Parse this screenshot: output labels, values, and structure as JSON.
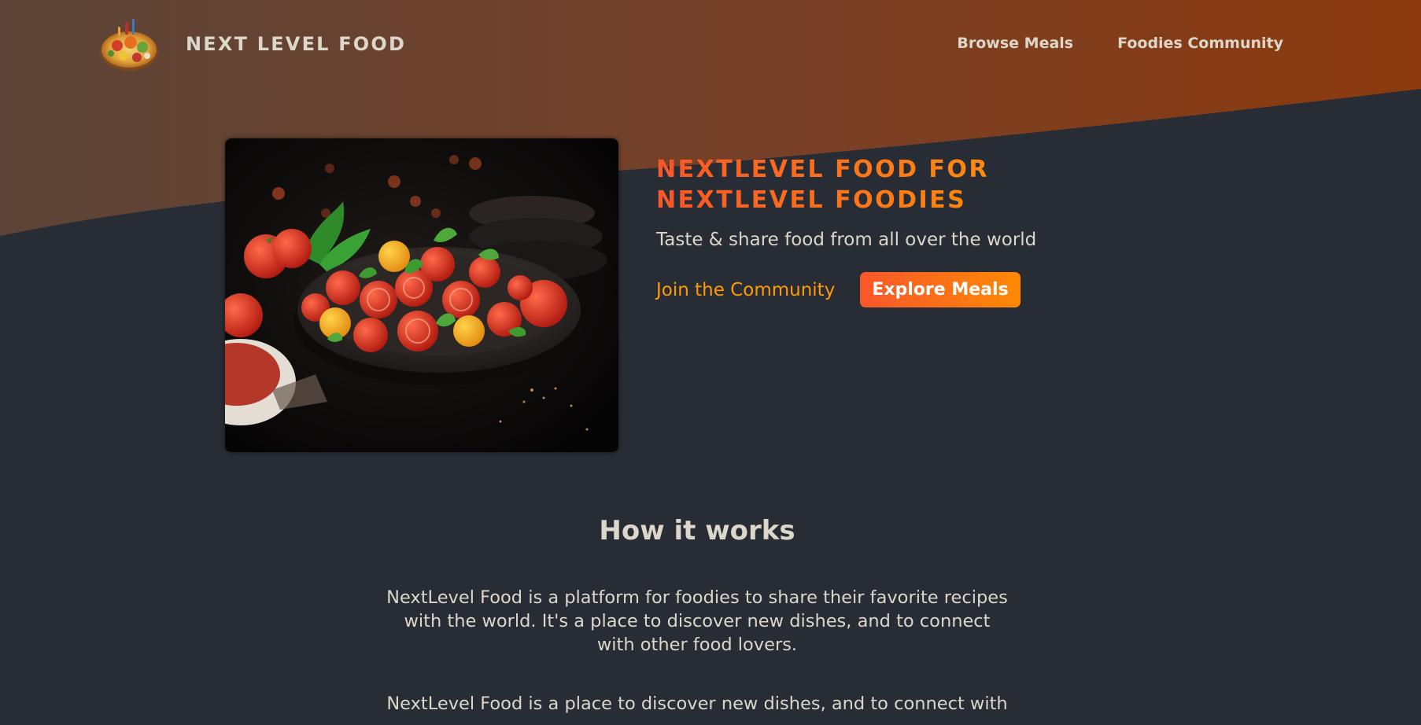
{
  "header": {
    "logo_alt": "A plate with food on it",
    "brand": "NEXT LEVEL FOOD",
    "nav": [
      {
        "label": "Browse Meals"
      },
      {
        "label": "Foodies Community"
      }
    ]
  },
  "hero": {
    "image_alt": "Bowl of sliced tomatoes with basil",
    "title_line1": "NEXTLEVEL FOOD FOR",
    "title_line2": "NEXTLEVEL FOODIES",
    "subtitle": "Taste & share food from all over the world",
    "join_link": "Join the Community",
    "explore_button": "Explore Meals"
  },
  "how_it_works": {
    "heading": "How it works",
    "paragraph1": "NextLevel Food is a platform for foodies to share their favorite recipes with the world. It's a place to discover new dishes, and to connect with other food lovers.",
    "paragraph2": "NextLevel Food is a place to discover new dishes, and to connect with"
  },
  "colors": {
    "background": "#282c34",
    "text": "#ddd6cb",
    "accent_start": "#f9572a",
    "accent_end": "#ff9b05",
    "header_brown": "#6a4a36",
    "header_orange": "#8a3c10"
  },
  "icons": {
    "logo": "food-plate-logo-icon"
  }
}
